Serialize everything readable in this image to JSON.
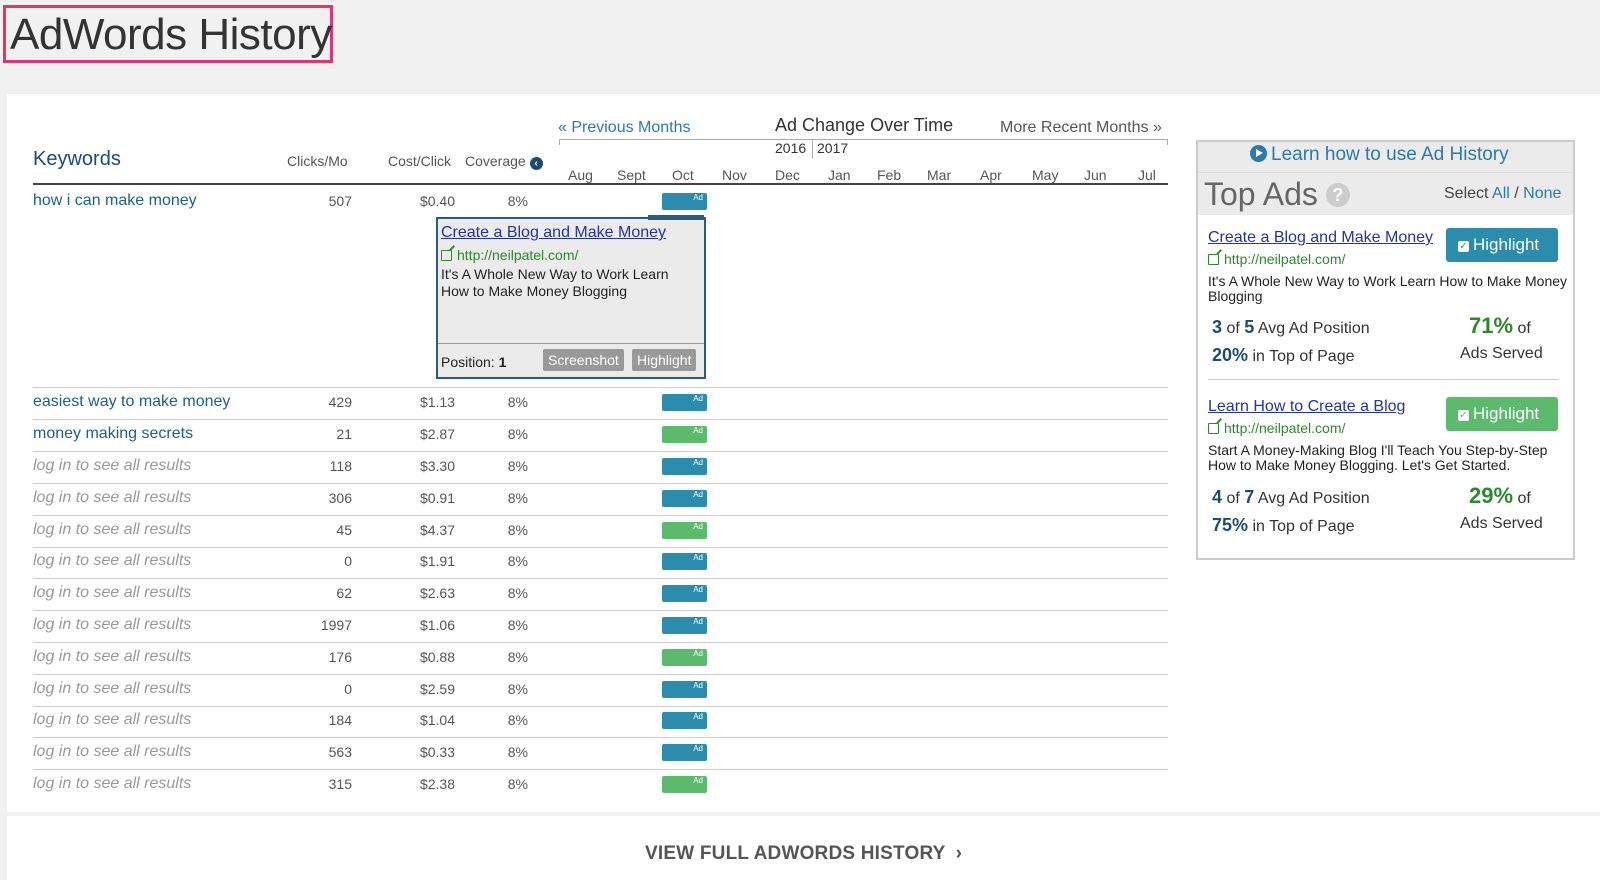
{
  "page_title": "AdWords History",
  "table": {
    "headers": {
      "keywords": "Keywords",
      "clicks": "Clicks/Mo",
      "cost": "Cost/Click",
      "coverage": "Coverage"
    },
    "prev_months": "« Previous Months",
    "ad_change": "Ad Change Over Time",
    "more_months": "More Recent Months »",
    "years": [
      "2016",
      "2017"
    ],
    "months": [
      "Aug",
      "Sept",
      "Oct",
      "Nov",
      "Dec",
      "Jan",
      "Feb",
      "Mar",
      "Apr",
      "May",
      "Jun",
      "Jul"
    ],
    "ad_badge_label": "Ad",
    "rows": [
      {
        "keyword": "how i can make money",
        "clicks": "507",
        "cost": "$0.40",
        "coverage": "8%",
        "ad_color": "blue",
        "locked": false
      },
      {
        "keyword": "easiest way to make money",
        "clicks": "429",
        "cost": "$1.13",
        "coverage": "8%",
        "ad_color": "blue",
        "locked": false
      },
      {
        "keyword": "money making secrets",
        "clicks": "21",
        "cost": "$2.87",
        "coverage": "8%",
        "ad_color": "green",
        "locked": false
      },
      {
        "keyword": "log in to see all results",
        "clicks": "118",
        "cost": "$3.30",
        "coverage": "8%",
        "ad_color": "blue",
        "locked": true
      },
      {
        "keyword": "log in to see all results",
        "clicks": "306",
        "cost": "$0.91",
        "coverage": "8%",
        "ad_color": "blue",
        "locked": true
      },
      {
        "keyword": "log in to see all results",
        "clicks": "45",
        "cost": "$4.37",
        "coverage": "8%",
        "ad_color": "green",
        "locked": true
      },
      {
        "keyword": "log in to see all results",
        "clicks": "0",
        "cost": "$1.91",
        "coverage": "8%",
        "ad_color": "blue",
        "locked": true
      },
      {
        "keyword": "log in to see all results",
        "clicks": "62",
        "cost": "$2.63",
        "coverage": "8%",
        "ad_color": "blue",
        "locked": true
      },
      {
        "keyword": "log in to see all results",
        "clicks": "1997",
        "cost": "$1.06",
        "coverage": "8%",
        "ad_color": "blue",
        "locked": true
      },
      {
        "keyword": "log in to see all results",
        "clicks": "176",
        "cost": "$0.88",
        "coverage": "8%",
        "ad_color": "green",
        "locked": true
      },
      {
        "keyword": "log in to see all results",
        "clicks": "0",
        "cost": "$2.59",
        "coverage": "8%",
        "ad_color": "blue",
        "locked": true
      },
      {
        "keyword": "log in to see all results",
        "clicks": "184",
        "cost": "$1.04",
        "coverage": "8%",
        "ad_color": "blue",
        "locked": true
      },
      {
        "keyword": "log in to see all results",
        "clicks": "563",
        "cost": "$0.33",
        "coverage": "8%",
        "ad_color": "blue",
        "locked": true
      },
      {
        "keyword": "log in to see all results",
        "clicks": "315",
        "cost": "$2.38",
        "coverage": "8%",
        "ad_color": "green",
        "locked": true
      }
    ]
  },
  "popup": {
    "title": "Create a Blog and Make Money",
    "url": "http://neilpatel.com/",
    "description": "It's A Whole New Way to Work Learn How to Make Money Blogging",
    "position_label": "Position:",
    "position_value": "1",
    "screenshot_label": "Screenshot",
    "highlight_label": "Highlight"
  },
  "top_ads": {
    "learn_label": "Learn how to use Ad History",
    "heading": "Top Ads",
    "help_glyph": "?",
    "select_label": "Select",
    "select_all": "All",
    "select_sep": "/",
    "select_none": "None",
    "ads": [
      {
        "title": "Create a Blog and Make Money",
        "url": "http://neilpatel.com/",
        "description": "It's A Whole New Way to Work Learn How to Make Money Blogging",
        "highlight_label": "Highlight",
        "pos": "3",
        "of_label": "of",
        "total": "5",
        "avg_label": "Avg Ad Position",
        "top_pct": "20%",
        "top_label": "in Top of Page",
        "served_pct": "71%",
        "served_of": "of",
        "served_label": "Ads Served"
      },
      {
        "title": "Learn How to Create a Blog",
        "url": "http://neilpatel.com/",
        "description": "Start A Money-Making Blog I'll Teach You Step-by-Step How to Make Money Blogging. Let's Get Started.",
        "highlight_label": "Highlight",
        "pos": "4",
        "of_label": "of",
        "total": "7",
        "avg_label": "Avg Ad Position",
        "top_pct": "75%",
        "top_label": "in Top of Page",
        "served_pct": "29%",
        "served_of": "of",
        "served_label": "Ads Served"
      }
    ]
  },
  "footer": {
    "view_full": "VIEW FULL ADWORDS HISTORY",
    "chevron": "›"
  }
}
